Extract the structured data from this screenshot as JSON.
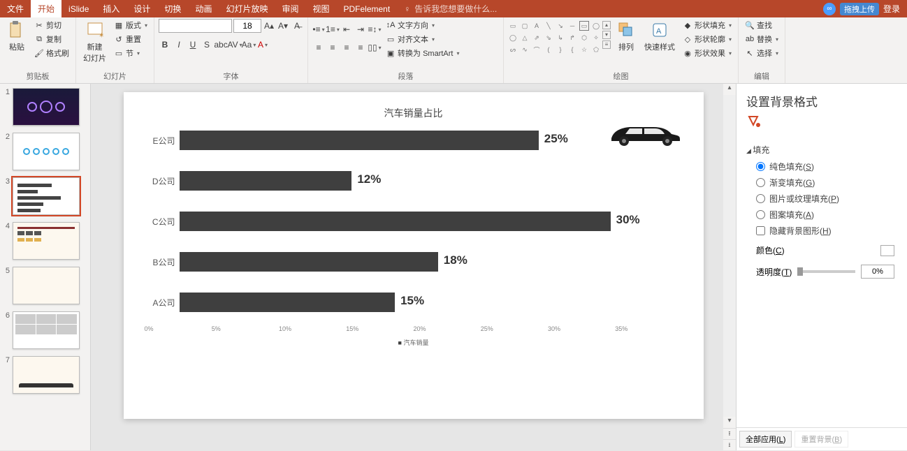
{
  "tabs": [
    "文件",
    "开始",
    "iSlide",
    "插入",
    "设计",
    "切换",
    "动画",
    "幻灯片放映",
    "审阅",
    "视图",
    "PDFelement"
  ],
  "active_tab": "开始",
  "help_placeholder": "告诉我您想要做什么...",
  "upload_btn": "拖拽上传",
  "login": "登录",
  "ribbon": {
    "clipboard": {
      "paste": "粘贴",
      "cut": "剪切",
      "copy": "复制",
      "painter": "格式刷",
      "label": "剪贴板"
    },
    "slides": {
      "new": "新建\n幻灯片",
      "layout": "版式",
      "reset": "重置",
      "section": "节",
      "label": "幻灯片"
    },
    "font": {
      "size": "18",
      "label": "字体"
    },
    "para": {
      "dir": "文字方向",
      "align": "对齐文本",
      "smartart": "转换为 SmartArt",
      "label": "段落"
    },
    "draw": {
      "arrange": "排列",
      "quick": "快速样式",
      "fill": "形状填充",
      "outline": "形状轮廓",
      "effect": "形状效果",
      "label": "绘图"
    },
    "edit": {
      "find": "查找",
      "replace": "替换",
      "select": "选择",
      "label": "编辑"
    }
  },
  "sidepanel": {
    "title": "设置背景格式",
    "section_fill": "填充",
    "opt_solid": "纯色填充(S)",
    "opt_grad": "渐变填充(G)",
    "opt_pic": "图片或纹理填充(P)",
    "opt_pattern": "图案填充(A)",
    "opt_hide": "隐藏背景图形(H)",
    "color": "颜色(C)",
    "trans": "透明度(T)",
    "trans_val": "0%",
    "apply_all": "全部应用(L)",
    "reset_bg": "重置背景(B)"
  },
  "thumbs": [
    1,
    2,
    3,
    4,
    5,
    6,
    7
  ],
  "selected_thumb": 3,
  "chart_data": {
    "type": "bar",
    "title": "汽车销量占比",
    "legend": "汽车销量",
    "categories": [
      "E公司",
      "D公司",
      "C公司",
      "B公司",
      "A公司"
    ],
    "values": [
      25,
      12,
      30,
      18,
      15
    ],
    "value_labels": [
      "25%",
      "12%",
      "30%",
      "18%",
      "15%"
    ],
    "xticks": [
      "0%",
      "5%",
      "10%",
      "15%",
      "20%",
      "25%",
      "30%",
      "35%"
    ],
    "xmax": 35
  }
}
